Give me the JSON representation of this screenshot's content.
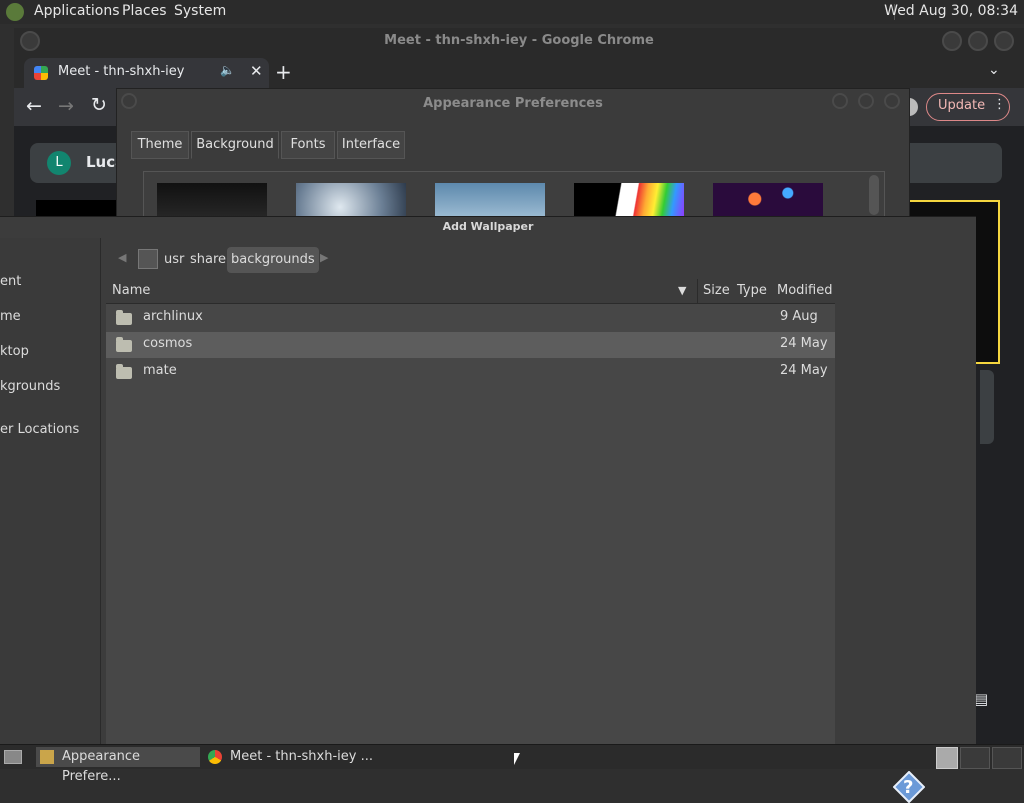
{
  "top_panel": {
    "menus": [
      "Applications",
      "Places",
      "System"
    ],
    "clock": "Wed Aug 30, 08:34"
  },
  "chrome": {
    "title": "Meet - thn-shxh-iey - Google Chrome",
    "tab_title": "Meet - thn-shxh-iey",
    "update_label": "Update",
    "meet_avatar_letter": "L",
    "meet_user": "Luca"
  },
  "appearance": {
    "title": "Appearance Preferences",
    "tabs": [
      "Theme",
      "Background",
      "Fonts",
      "Interface"
    ],
    "active_tab": "Background"
  },
  "dialog": {
    "title": "Add Wallpaper",
    "sidebar": [
      "ent",
      "me",
      "ktop",
      "kgrounds",
      "er Locations"
    ],
    "path": [
      "usr",
      "share",
      "backgrounds"
    ],
    "columns": {
      "name": "Name",
      "size": "Size",
      "type": "Type",
      "modified": "Modified"
    },
    "files": [
      {
        "name": "archlinux",
        "modified": "9 Aug"
      },
      {
        "name": "cosmos",
        "modified": "24 May"
      },
      {
        "name": "mate",
        "modified": "24 May"
      }
    ],
    "help_glyph": "?"
  },
  "taskbar": {
    "items": [
      "Appearance Prefere...",
      "Meet - thn-shxh-iey ..."
    ]
  },
  "colors": {
    "accent_update": "#f2b8b5",
    "meet_avatar": "#12856f"
  }
}
